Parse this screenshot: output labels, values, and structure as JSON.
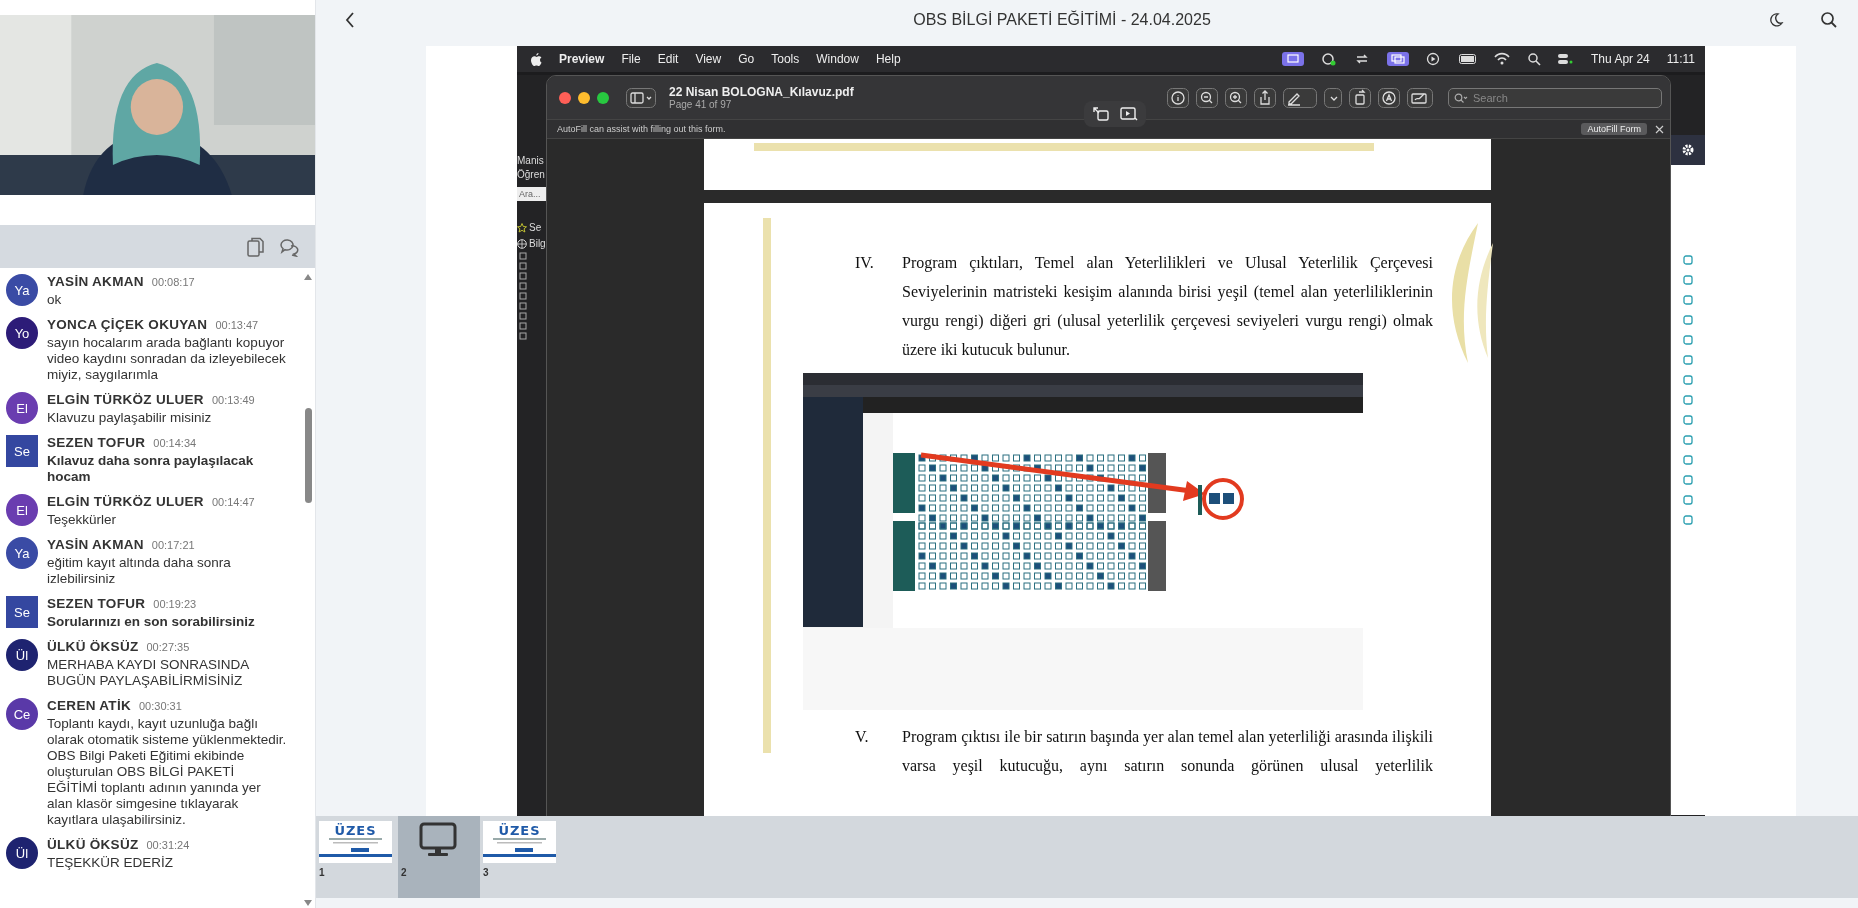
{
  "header": {
    "title": "OBS BİLGİ PAKETİ EĞİTİMİ - 24.04.2025"
  },
  "chat": {
    "messages": [
      {
        "initials": "Ya",
        "color": "#3a4ba5",
        "kind": "circle",
        "name": "YASİN AKMAN",
        "time": "00:08:17",
        "text": "ok",
        "bold": false
      },
      {
        "initials": "Yo",
        "color": "#2d1c78",
        "kind": "circle",
        "name": "YONCA ÇİÇEK OKUYAN",
        "time": "00:13:47",
        "text": "sayın hocalarım arada bağlantı kopuyor video kaydını sonradan da izleyebilecek miyiz, saygılarımla",
        "bold": false
      },
      {
        "initials": "El",
        "color": "#6a3db0",
        "kind": "circle",
        "name": "ELGİN TÜRKÖZ ULUER",
        "time": "00:13:49",
        "text": "Klavuzu paylaşabilir misiniz",
        "bold": false
      },
      {
        "initials": "Se",
        "color": "#3447a0",
        "kind": "square",
        "name": "SEZEN TOFUR",
        "time": "00:14:34",
        "text": "Kılavuz daha sonra paylaşılacak hocam",
        "bold": true
      },
      {
        "initials": "El",
        "color": "#6a3db0",
        "kind": "circle",
        "name": "ELGİN TÜRKÖZ ULUER",
        "time": "00:14:47",
        "text": "Teşekkürler",
        "bold": false
      },
      {
        "initials": "Ya",
        "color": "#3a4ba5",
        "kind": "circle",
        "name": "YASİN AKMAN",
        "time": "00:17:21",
        "text": "eğitim kayıt altında daha sonra izlebilirsiniz",
        "bold": false
      },
      {
        "initials": "Se",
        "color": "#3447a0",
        "kind": "square",
        "name": "SEZEN TOFUR",
        "time": "00:19:23",
        "text": "Sorularınızı en son sorabilirsiniz",
        "bold": true
      },
      {
        "initials": "Ül",
        "color": "#1e2370",
        "kind": "circle",
        "name": "ÜLKÜ ÖKSÜZ",
        "time": "00:27:35",
        "text": "MERHABA KAYDI SONRASINDA BUGÜN PAYLAŞABİLİRMİSİNİZ",
        "bold": false
      },
      {
        "initials": "Ce",
        "color": "#5a39a8",
        "kind": "circle",
        "name": "CEREN ATİK",
        "time": "00:30:31",
        "text": "Toplantı kaydı, kayıt uzunluğa bağlı olarak otomatik sisteme yüklenmektedir. OBS Bilgi Paketi Eğitimi ekibinde oluşturulan OBS BİLGİ PAKETİ EĞİTİMİ toplantı adının yanında yer alan klasör simgesine tıklayarak kayıtlara ulaşabilirsiniz.",
        "bold": false
      },
      {
        "initials": "Ül",
        "color": "#1e2370",
        "kind": "circle",
        "name": "ÜLKÜ ÖKSÜZ",
        "time": "00:31:24",
        "text": "TEŞEKKÜR EDERİZ",
        "bold": false
      }
    ]
  },
  "shared_screen": {
    "menu_bar": {
      "app": "Preview",
      "menus": [
        "File",
        "Edit",
        "View",
        "Go",
        "Tools",
        "Window",
        "Help"
      ],
      "date": "Thu Apr 24",
      "time": "11:11"
    },
    "background_app": {
      "texts": [
        "Manis",
        "Öğren"
      ],
      "search_placeholder": "Ara...",
      "items": [
        "Se",
        "Bilg"
      ]
    },
    "preview": {
      "file_name": "22 Nisan BOLOGNA_Kılavuz.pdf",
      "page_info": "Page 41 of 97",
      "search_placeholder": "Search",
      "autofill_message": "AutoFill can assist with filling out this form.",
      "autofill_button": "AutoFill Form",
      "paragraphs": [
        {
          "number": "IV.",
          "text": "Program çıktıları, Temel alan Yeterlilikleri ve Ulusal Yeterlilik Çerçevesi Seviyelerinin matristeki kesişim alanında birisi yeşil (temel alan yeterliliklerinin vurgu rengi) diğeri gri (ulusal yeterlilik çerçevesi seviyeleri vurgu rengi) olmak üzere iki kutucuk bulunur.",
          "cut_off": false
        },
        {
          "number": "V.",
          "text": "Program çıktısı ile bir satırın başında yer alan temel alan yeterliliği arasında ilişkili varsa yeşil kutucuğu, aynı satırın sonunda görünen ulusal yeterlilik",
          "cut_off": true
        }
      ]
    }
  },
  "thumbnails": [
    {
      "label": "1",
      "kind": "slide",
      "title": "ÜZES",
      "selected": false
    },
    {
      "label": "2",
      "kind": "screen",
      "selected": true
    },
    {
      "label": "3",
      "kind": "slide",
      "title": "ÜZES",
      "selected": false
    }
  ]
}
